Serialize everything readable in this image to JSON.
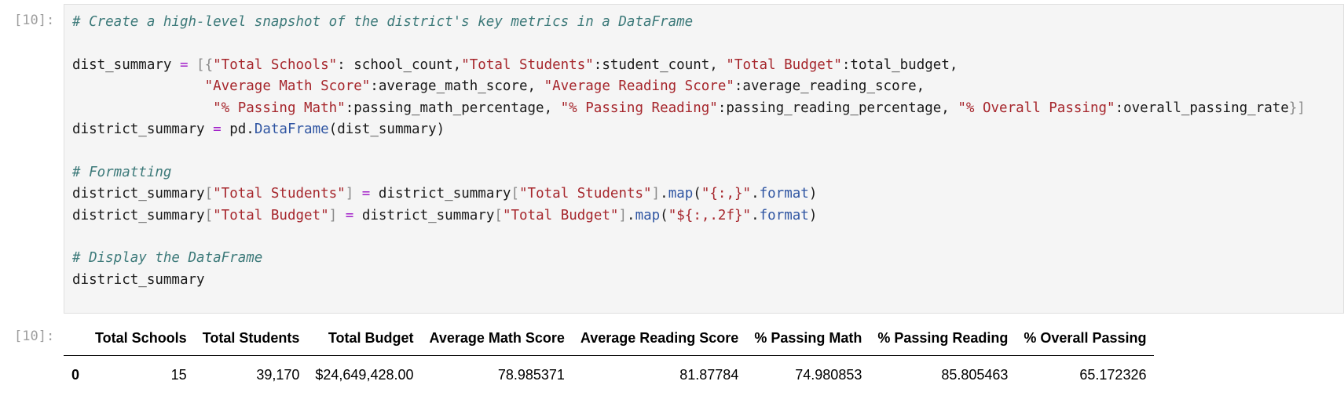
{
  "input_cell": {
    "prompt": "[10]:",
    "lines": [
      [
        {
          "t": "# Create a high-level snapshot of the district's key metrics in a DataFrame",
          "c": "comment"
        }
      ],
      [],
      [
        {
          "t": "dist_summary ",
          "c": "id"
        },
        {
          "t": "=",
          "c": "op"
        },
        {
          "t": " [{",
          "c": "punc"
        },
        {
          "t": "\"Total Schools\"",
          "c": "string"
        },
        {
          "t": ": school_count,",
          "c": "id"
        },
        {
          "t": "\"Total Students\"",
          "c": "string"
        },
        {
          "t": ":student_count, ",
          "c": "id"
        },
        {
          "t": "\"Total Budget\"",
          "c": "string"
        },
        {
          "t": ":total_budget,",
          "c": "id"
        }
      ],
      [
        {
          "t": "                ",
          "c": "id"
        },
        {
          "t": "\"Average Math Score\"",
          "c": "string"
        },
        {
          "t": ":average_math_score, ",
          "c": "id"
        },
        {
          "t": "\"Average Reading Score\"",
          "c": "string"
        },
        {
          "t": ":average_reading_score,",
          "c": "id"
        }
      ],
      [
        {
          "t": "                 ",
          "c": "id"
        },
        {
          "t": "\"% Passing Math\"",
          "c": "string"
        },
        {
          "t": ":passing_math_percentage, ",
          "c": "id"
        },
        {
          "t": "\"% Passing Reading\"",
          "c": "string"
        },
        {
          "t": ":passing_reading_percentage, ",
          "c": "id"
        },
        {
          "t": "\"% Overall Passing\"",
          "c": "string"
        },
        {
          "t": ":overall_passing_rate",
          "c": "id"
        },
        {
          "t": "}]",
          "c": "punc"
        }
      ],
      [
        {
          "t": "district_summary ",
          "c": "id"
        },
        {
          "t": "=",
          "c": "op"
        },
        {
          "t": " pd.",
          "c": "id"
        },
        {
          "t": "DataFrame",
          "c": "func"
        },
        {
          "t": "(dist_summary)",
          "c": "id"
        }
      ],
      [],
      [
        {
          "t": "# Formatting",
          "c": "comment"
        }
      ],
      [
        {
          "t": "district_summary",
          "c": "id"
        },
        {
          "t": "[",
          "c": "punc"
        },
        {
          "t": "\"Total Students\"",
          "c": "string"
        },
        {
          "t": "]",
          "c": "punc"
        },
        {
          "t": " ",
          "c": "id"
        },
        {
          "t": "=",
          "c": "op"
        },
        {
          "t": " district_summary",
          "c": "id"
        },
        {
          "t": "[",
          "c": "punc"
        },
        {
          "t": "\"Total Students\"",
          "c": "string"
        },
        {
          "t": "]",
          "c": "punc"
        },
        {
          "t": ".",
          "c": "id"
        },
        {
          "t": "map",
          "c": "func"
        },
        {
          "t": "(",
          "c": "id"
        },
        {
          "t": "\"{:,}\"",
          "c": "string"
        },
        {
          "t": ".",
          "c": "id"
        },
        {
          "t": "format",
          "c": "func"
        },
        {
          "t": ")",
          "c": "id"
        }
      ],
      [
        {
          "t": "district_summary",
          "c": "id"
        },
        {
          "t": "[",
          "c": "punc"
        },
        {
          "t": "\"Total Budget\"",
          "c": "string"
        },
        {
          "t": "]",
          "c": "punc"
        },
        {
          "t": " ",
          "c": "id"
        },
        {
          "t": "=",
          "c": "op"
        },
        {
          "t": " district_summary",
          "c": "id"
        },
        {
          "t": "[",
          "c": "punc"
        },
        {
          "t": "\"Total Budget\"",
          "c": "string"
        },
        {
          "t": "]",
          "c": "punc"
        },
        {
          "t": ".",
          "c": "id"
        },
        {
          "t": "map",
          "c": "func"
        },
        {
          "t": "(",
          "c": "id"
        },
        {
          "t": "\"${:,.2f}\"",
          "c": "string"
        },
        {
          "t": ".",
          "c": "id"
        },
        {
          "t": "format",
          "c": "func"
        },
        {
          "t": ")",
          "c": "id"
        }
      ],
      [],
      [
        {
          "t": "# Display the DataFrame",
          "c": "comment"
        }
      ],
      [
        {
          "t": "district_summary",
          "c": "id"
        }
      ]
    ]
  },
  "output_cell": {
    "prompt": "[10]:",
    "table": {
      "index_header": "",
      "columns": [
        "Total Schools",
        "Total Students",
        "Total Budget",
        "Average Math Score",
        "Average Reading Score",
        "% Passing Math",
        "% Passing Reading",
        "% Overall Passing"
      ],
      "rows": [
        {
          "index": "0",
          "values": [
            "15",
            "39,170",
            "$24,649,428.00",
            "78.985371",
            "81.87784",
            "74.980853",
            "85.805463",
            "65.172326"
          ]
        }
      ]
    }
  },
  "colors": {
    "code_background": "#f5f5f5",
    "comment": "#3d7a7a",
    "string": "#a6262c",
    "operator": "#a220c9",
    "function": "#2f55a2",
    "prompt": "#9e9e9e"
  }
}
